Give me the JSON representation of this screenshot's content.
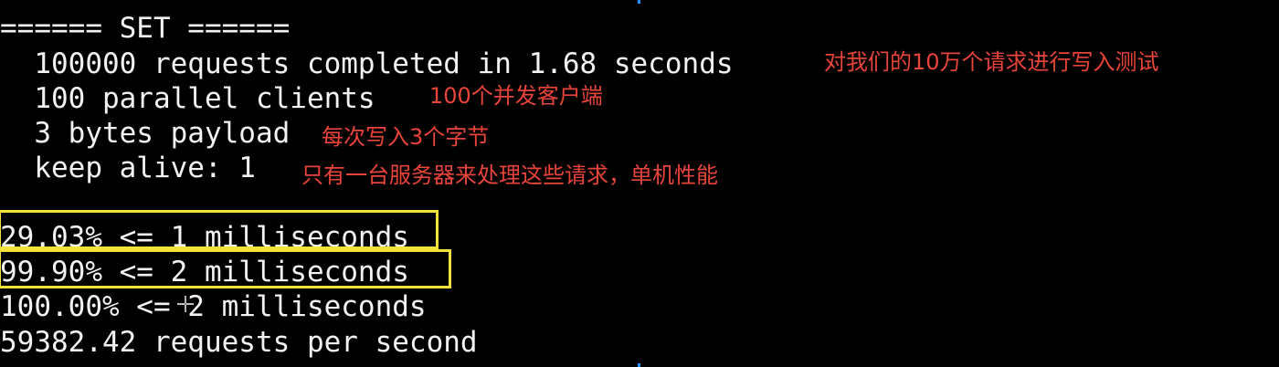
{
  "terminal": {
    "lines": [
      "====== SET ======",
      "  100000 requests completed in 1.68 seconds",
      "  100 parallel clients",
      "  3 bytes payload",
      "  keep alive: 1",
      "",
      "29.03% <= 1 milliseconds",
      "99.90% <= 2 milliseconds",
      "100.00% <= 2 milliseconds",
      "59382.42 requests per second"
    ]
  },
  "annotations": [
    "对我们的10万个请求进行写入测试",
    "100个并发客户端",
    "每次写入3个字节",
    "只有一台服务器来处理这些请求，单机性能"
  ],
  "colors": {
    "background": "#000000",
    "text": "#f2f2f2",
    "annotation": "#e8443a",
    "highlight_box": "#f3e23a"
  },
  "icons": {
    "cursor": "crosshair-cursor-icon"
  }
}
